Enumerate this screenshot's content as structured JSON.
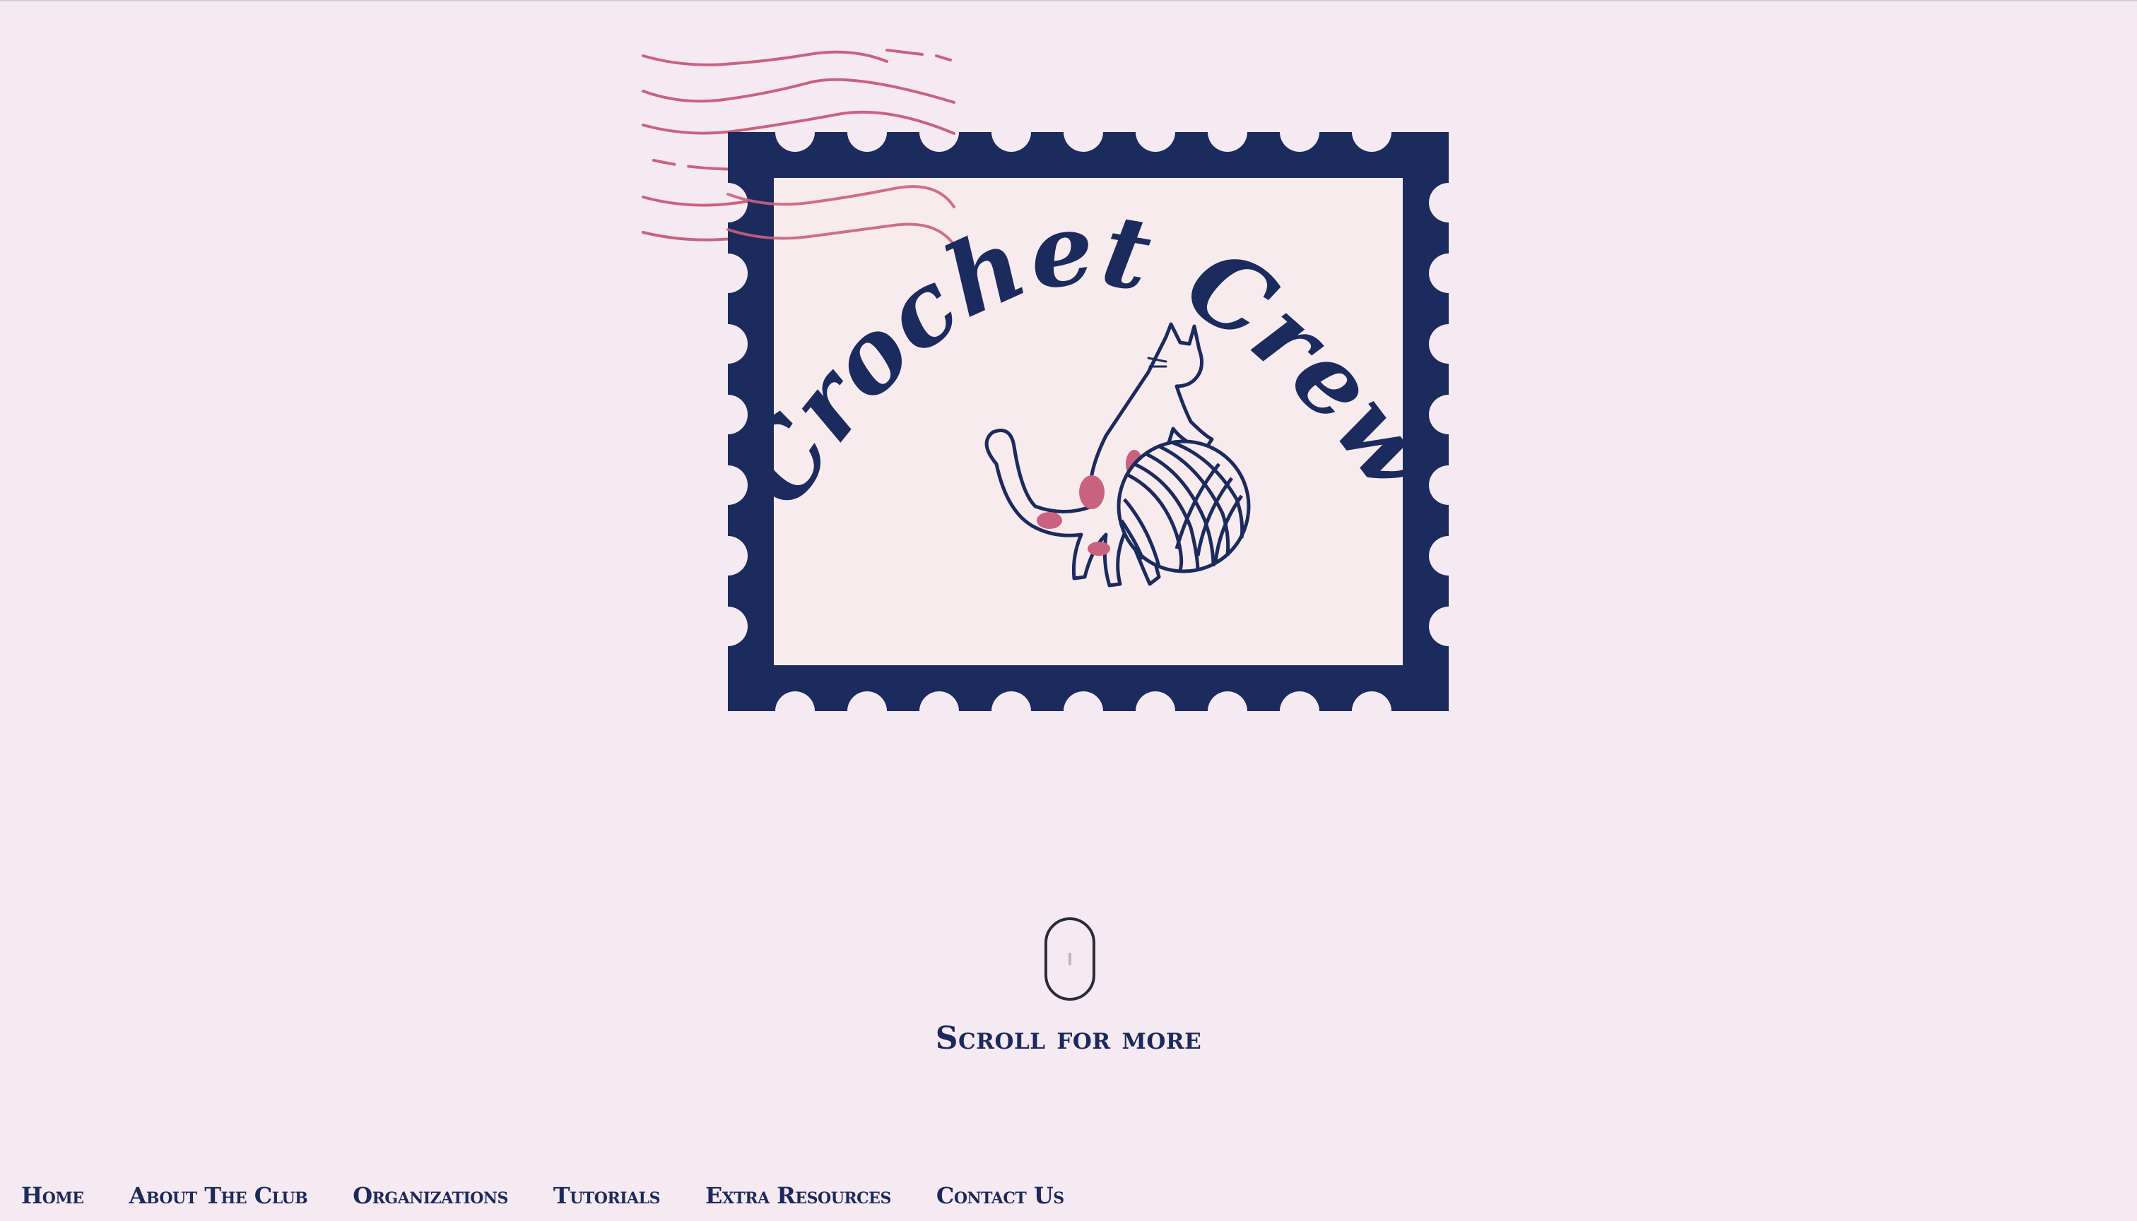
{
  "logo": {
    "text": "Crochet Crew",
    "icon": "crochet-crew-stamp-logo",
    "colors": {
      "navy": "#1c2b5e",
      "pink": "#c9627f",
      "cream": "#f7ebee"
    }
  },
  "scroll": {
    "icon": "mouse-scroll-icon",
    "label": "Scroll for more"
  },
  "nav": {
    "items": [
      {
        "label": "Home"
      },
      {
        "label": "About The Club"
      },
      {
        "label": "Organizations"
      },
      {
        "label": "Tutorials"
      },
      {
        "label": "Extra Resources"
      },
      {
        "label": "Contact Us"
      }
    ]
  }
}
